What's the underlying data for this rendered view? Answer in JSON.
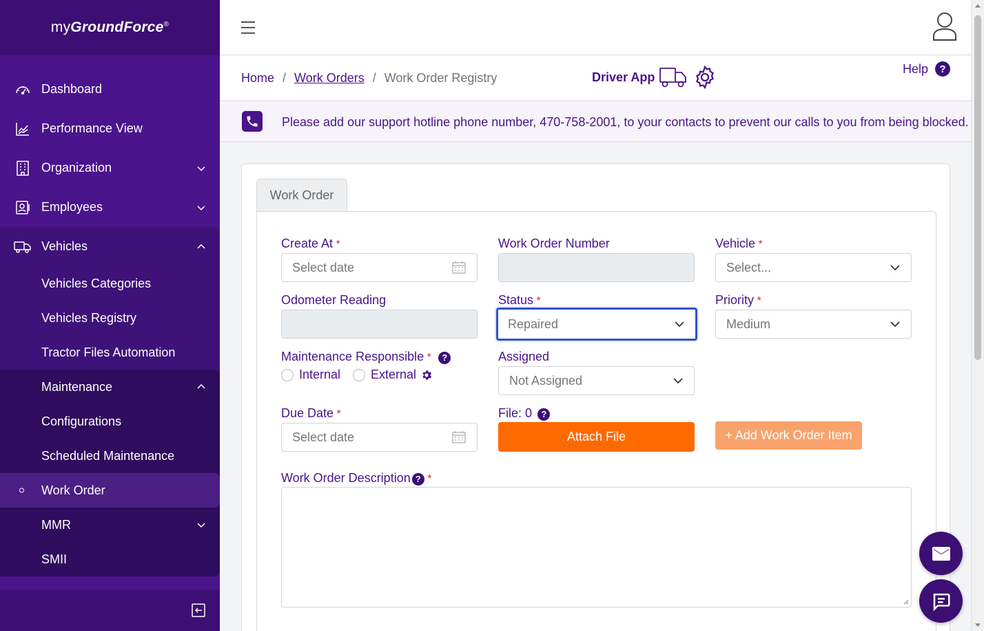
{
  "brand": {
    "prefix": "my",
    "name": "GroundForce",
    "mark": "®"
  },
  "sidebar": {
    "items": [
      {
        "label": "Dashboard",
        "icon": "gauge-icon"
      },
      {
        "label": "Performance View",
        "icon": "chart-line-icon"
      },
      {
        "label": "Organization",
        "icon": "building-icon"
      },
      {
        "label": "Employees",
        "icon": "id-card-icon"
      },
      {
        "label": "Vehicles",
        "icon": "truck-icon"
      }
    ],
    "vehicles_sub": [
      "Vehicles Categories",
      "Vehicles Registry",
      "Tractor Files Automation"
    ],
    "maintenance_label": "Maintenance",
    "maintenance_sub": [
      "Configurations",
      "Scheduled Maintenance",
      "Work Order",
      "MMR",
      "SMII"
    ]
  },
  "breadcrumb": {
    "home": "Home",
    "sep": "/",
    "work_orders": "Work Orders",
    "current": "Work Order Registry"
  },
  "driver_app": "Driver App",
  "help": {
    "label": "Help",
    "icon_text": "?"
  },
  "notice": "Please add our support hotline phone number, 470-758-2001, to your contacts to prevent our calls to you from being blocked.",
  "form": {
    "tab": "Work Order",
    "create_at": {
      "label": "Create At",
      "placeholder": "Select date"
    },
    "wo_number": {
      "label": "Work Order Number",
      "value": ""
    },
    "vehicle": {
      "label": "Vehicle",
      "value": "Select..."
    },
    "odometer": {
      "label": "Odometer Reading",
      "value": ""
    },
    "status": {
      "label": "Status",
      "value": "Repaired"
    },
    "priority": {
      "label": "Priority",
      "value": "Medium"
    },
    "maint_resp": {
      "label": "Maintenance Responsible",
      "internal": "Internal",
      "external": "External"
    },
    "assigned": {
      "label": "Assigned",
      "value": "Not Assigned"
    },
    "due_date": {
      "label": "Due Date",
      "placeholder": "Select date"
    },
    "file": {
      "label": "File: 0",
      "button": "Attach File"
    },
    "add_item": "+ Add Work Order Item",
    "description": {
      "label": "Work Order Description"
    },
    "required_mark": "*",
    "qmark": "?"
  },
  "colors": {
    "primary": "#4a148c",
    "accent": "#ff6a00",
    "focus": "#2f55c8"
  }
}
